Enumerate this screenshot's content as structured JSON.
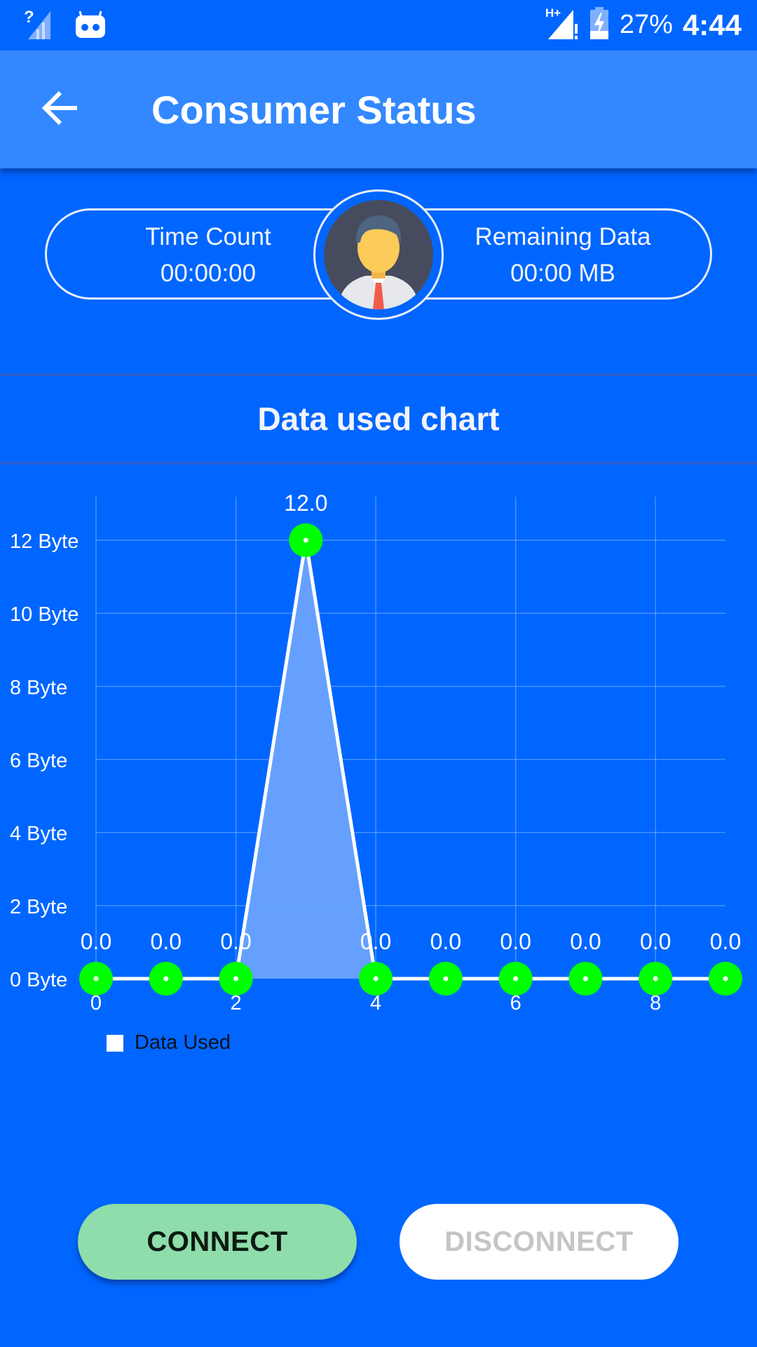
{
  "status_bar": {
    "network_unknown_icon": "signal-unknown-icon",
    "app_icon": "cyanogen-mascot-icon",
    "network_type": "H+",
    "battery_percent": "27%",
    "time": "4:44"
  },
  "app_bar": {
    "back_icon": "arrow-left-icon",
    "title": "Consumer Status"
  },
  "info": {
    "time_count_label": "Time Count",
    "time_count_value": "00:00:00",
    "remaining_data_label": "Remaining Data",
    "remaining_data_value": "00:00 MB",
    "avatar_icon": "user-avatar-icon"
  },
  "section": {
    "title": "Data used chart"
  },
  "chart_data": {
    "type": "line",
    "title": "Data used chart",
    "xlabel": "",
    "ylabel": "",
    "x": [
      0,
      1,
      2,
      3,
      4,
      5,
      6,
      7,
      8,
      9
    ],
    "series": [
      {
        "name": "Data Used",
        "values": [
          0.0,
          0.0,
          0.0,
          12.0,
          0.0,
          0.0,
          0.0,
          0.0,
          0.0,
          0.0
        ],
        "value_labels": [
          "0.0",
          "0.0",
          "0.0",
          "12.0",
          "0.0",
          "0.0",
          "0.0",
          "0.0",
          "0.0",
          "0.0"
        ],
        "fill": true,
        "line_color": "#FFFFFF",
        "fill_color": "#6AA3FF",
        "marker_color": "#00FF00"
      }
    ],
    "xlim": [
      0,
      9
    ],
    "ylim": [
      0,
      13
    ],
    "x_ticks": [
      0,
      2,
      4,
      6,
      8
    ],
    "x_tick_labels": [
      "0",
      "2",
      "4",
      "6",
      "8"
    ],
    "y_ticks": [
      0,
      2,
      4,
      6,
      8,
      10,
      12
    ],
    "y_tick_labels": [
      "0  Byte",
      "2  Byte",
      "4  Byte",
      "6  Byte",
      "8  Byte",
      "10  Byte",
      "12  Byte"
    ],
    "grid": true,
    "legend": "bottom-left"
  },
  "legend": {
    "label": "Data Used"
  },
  "buttons": {
    "connect": "CONNECT",
    "disconnect": "DISCONNECT"
  },
  "colors": {
    "background": "#0066FF",
    "app_bar": "#3388FF",
    "connect_button": "#8EDDAA",
    "disconnect_button": "#FFFFFF",
    "marker": "#00FF00"
  }
}
